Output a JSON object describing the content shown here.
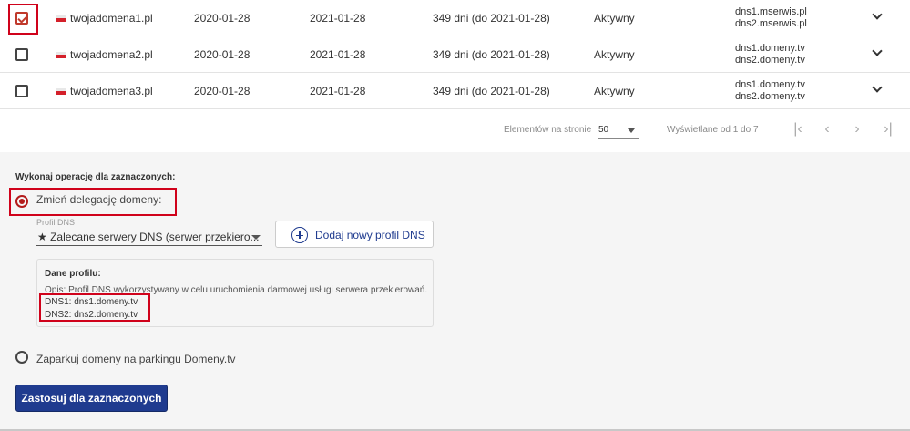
{
  "rows": [
    {
      "domain": "twojadomena1.pl",
      "created": "2020-01-28",
      "expires": "2021-01-28",
      "days": "349 dni (do 2021-01-28)",
      "status": "Aktywny",
      "dns1": "dns1.mserwis.pl",
      "dns2": "dns2.mserwis.pl",
      "checked": true
    },
    {
      "domain": "twojadomena2.pl",
      "created": "2020-01-28",
      "expires": "2021-01-28",
      "days": "349 dni (do 2021-01-28)",
      "status": "Aktywny",
      "dns1": "dns1.domeny.tv",
      "dns2": "dns2.domeny.tv",
      "checked": false
    },
    {
      "domain": "twojadomena3.pl",
      "created": "2020-01-28",
      "expires": "2021-01-28",
      "days": "349 dni (do 2021-01-28)",
      "status": "Aktywny",
      "dns1": "dns1.domeny.tv",
      "dns2": "dns2.domeny.tv",
      "checked": false
    }
  ],
  "pager": {
    "per_page_label": "Elementów na stronie",
    "per_page_value": "50",
    "range_label": "Wyświetlane od 1 do 7",
    "first_icon": "first-page-icon",
    "prev_icon": "prev-page-icon",
    "next_icon": "next-page-icon",
    "last_icon": "last-page-icon"
  },
  "operations": {
    "title": "Wykonaj operację dla zaznaczonych:",
    "option_delegation": "Zmień delegację domeny:",
    "profile_label": "Profil DNS",
    "profile_value": "★ Zalecane serwery DNS (serwer przekiero...",
    "add_profile_button": "Dodaj nowy profil DNS",
    "profile_info": {
      "title": "Dane profilu:",
      "description": "Opis: Profil DNS wykorzystywany w celu uruchomienia darmowej usługi serwera przekierowań.",
      "dns1": "DNS1: dns1.domeny.tv",
      "dns2": "DNS2: dns2.domeny.tv"
    },
    "option_parking": "Zaparkuj domeny na parkingu Domeny.tv",
    "apply_button": "Zastosuj dla zaznaczonych"
  },
  "colors": {
    "accent": "#1f3b8f",
    "highlight": "#d0021b"
  }
}
